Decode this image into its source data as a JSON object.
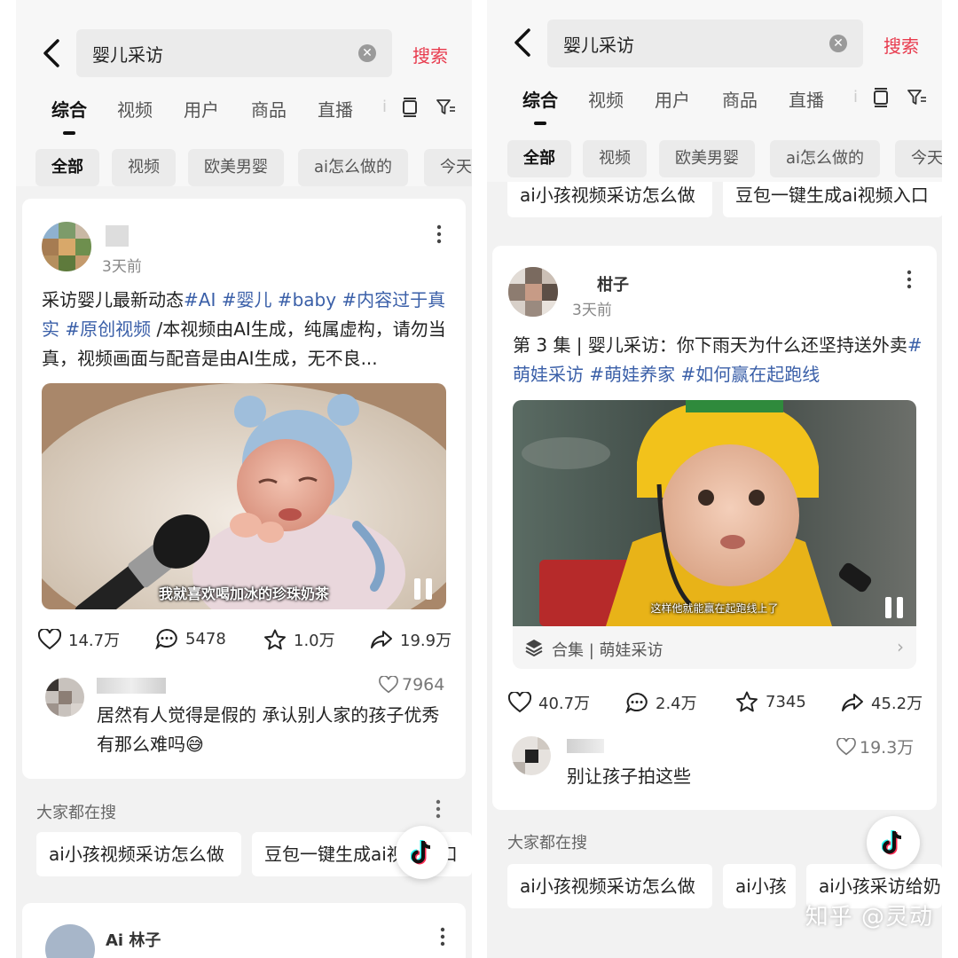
{
  "left": {
    "search": {
      "query": "婴儿采访",
      "button": "搜索"
    },
    "tabs": [
      "综合",
      "视频",
      "用户",
      "商品",
      "直播"
    ],
    "chips": [
      "全部",
      "视频",
      "欧美男婴",
      "ai怎么做的",
      "今天"
    ],
    "post": {
      "username": "",
      "time": "3天前",
      "desc_plain_1": "采访婴儿最新动态",
      "desc_tags_1": "#AI #婴儿 #baby #内容过于真实 #原创视频",
      "desc_plain_2": " /本视频由AI生成，纯属虚构，请勿当真，视频画面与配音是由AI生成，无不良...",
      "video_caption": "我就喜欢喝加冰的珍珠奶茶",
      "stats": {
        "likes": "14.7万",
        "comments": "5478",
        "favorites": "1.0万",
        "shares": "19.9万"
      },
      "comment": {
        "likes": "7964",
        "text": "居然有人觉得是假的 承认别人家的孩子优秀有那么难吗😅"
      }
    },
    "related": {
      "title": "大家都在搜",
      "items": [
        "ai小孩视频采访怎么做",
        "豆包一键生成ai视频入口"
      ]
    },
    "next_post_username": "Ai 林子"
  },
  "right": {
    "search": {
      "query": "婴儿采访",
      "button": "搜索"
    },
    "tabs": [
      "综合",
      "视频",
      "用户",
      "商品",
      "直播"
    ],
    "chips": [
      "全部",
      "视频",
      "欧美男婴",
      "ai怎么做的",
      "今天"
    ],
    "top_suggestions": [
      "ai小孩视频采访怎么做",
      "豆包一键生成ai视频入口"
    ],
    "post": {
      "username": "柑子",
      "time": "3天前",
      "desc_plain": "第 3 集 | 婴儿采访：你下雨天为什么还坚持送外卖",
      "desc_tags": "#萌娃采访 #萌娃养家 #如何赢在起跑线",
      "video_caption": "这样他就能赢在起跑线上了",
      "collection": "合集 | 萌娃采访",
      "stats": {
        "likes": "40.7万",
        "comments": "2.4万",
        "favorites": "7345",
        "shares": "45.2万"
      },
      "comment": {
        "likes": "19.3万",
        "text": "别让孩子拍这些"
      }
    },
    "related": {
      "title": "大家都在搜",
      "items": [
        "ai小孩视频采访怎么做",
        "ai小孩",
        "ai小孩采访给奶"
      ]
    }
  },
  "watermark": "知乎 @灵动",
  "colors": {
    "accent": "#e83a4d",
    "tag": "#3a5fa8"
  }
}
